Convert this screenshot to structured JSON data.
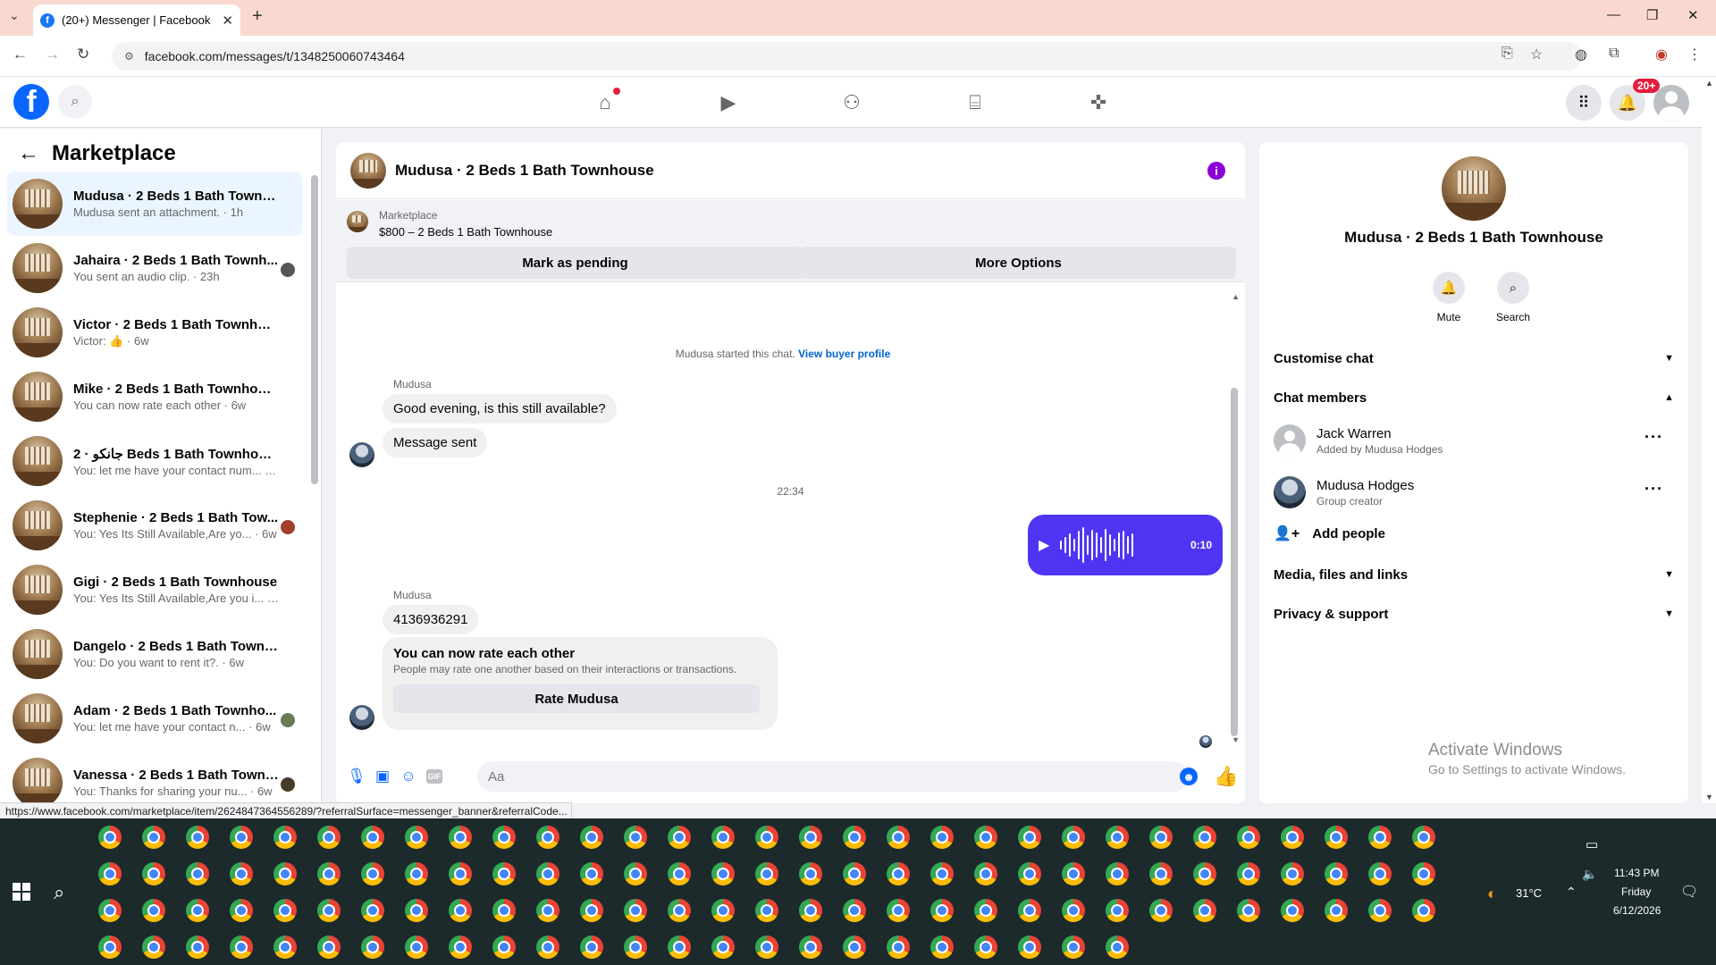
{
  "browser": {
    "tab_title": "(20+) Messenger | Facebook",
    "url": "facebook.com/messages/t/1348250060743464",
    "status_url": "https://www.facebook.com/marketplace/item/2624847364556289/?referralSurface=messenger_banner&referralCode..."
  },
  "fb_header": {
    "notification_count": "20+"
  },
  "left_panel": {
    "title": "Marketplace",
    "conversations": [
      {
        "name": "Mudusa · 2 Beds 1 Bath Townho...",
        "preview": "Mudusa sent an attachment. · 1h",
        "active": true
      },
      {
        "name": "Jahaira · 2 Beds 1 Bath Townh...",
        "preview": "You sent an audio clip. · 23h"
      },
      {
        "name": "Victor · 2 Beds 1 Bath Townhouse",
        "preview": "Victor: 👍 · 6w"
      },
      {
        "name": "Mike · 2 Beds 1 Bath Townhouse",
        "preview": "You can now rate each other · 6w"
      },
      {
        "name": "جانكو · 2 Beds 1 Bath Townhouse",
        "preview": "You: let me have your contact num... · 6w"
      },
      {
        "name": "Stephenie · 2 Beds 1 Bath Tow...",
        "preview": "You: Yes Its Still Available,Are yo... · 6w"
      },
      {
        "name": "Gigi · 2 Beds 1 Bath Townhouse",
        "preview": "You: Yes Its Still Available,Are you i... · 6w"
      },
      {
        "name": "Dangelo · 2 Beds 1 Bath Townho...",
        "preview": "You: Do you want to rent it?. · 6w"
      },
      {
        "name": "Adam · 2 Beds 1 Bath Townho...",
        "preview": "You: let me have your contact n... · 6w"
      },
      {
        "name": "Vanessa · 2 Beds 1 Bath Townh...",
        "preview": "You: Thanks for sharing your nu... · 6w"
      }
    ]
  },
  "chat": {
    "title": "Mudusa · 2 Beds 1 Bath Townhouse",
    "marketplace_label": "Marketplace",
    "listing": "$800 – 2 Beds 1 Bath Townhouse",
    "mark_pending": "Mark as pending",
    "more_options": "More Options",
    "started_text": "Mudusa started this chat.",
    "view_profile": "View buyer profile",
    "sender_1": "Mudusa",
    "msg_1": "Good evening, is this still available?",
    "msg_2": "Message sent",
    "time_divider": "22:34",
    "audio_duration": "0:10",
    "sender_2": "Mudusa",
    "msg_3": "4136936291",
    "rate_title": "You can now rate each other",
    "rate_desc": "People may rate one another based on their interactions or transactions.",
    "rate_button": "Rate Mudusa",
    "input_placeholder": "Aa",
    "gif_label": "GIF"
  },
  "right_panel": {
    "name": "Mudusa · 2 Beds 1 Bath Townhouse",
    "mute": "Mute",
    "search": "Search",
    "customise": "Customise chat",
    "chat_members": "Chat members",
    "members": [
      {
        "name": "Jack Warren",
        "sub": "Added by Mudusa Hodges"
      },
      {
        "name": "Mudusa Hodges",
        "sub": "Group creator"
      }
    ],
    "add_people": "Add people",
    "media": "Media, files and links",
    "privacy": "Privacy & support"
  },
  "watermark": {
    "line1": "Activate Windows",
    "line2": "Go to Settings to activate Windows."
  },
  "taskbar": {
    "temperature": "31°C",
    "time": "11:43 PM",
    "day": "Friday",
    "date": "6/12/2026"
  },
  "colors": {
    "fb_blue": "#0866ff",
    "audio_bubble": "#4e35f3",
    "tab_bar": "#f9d9cf"
  }
}
